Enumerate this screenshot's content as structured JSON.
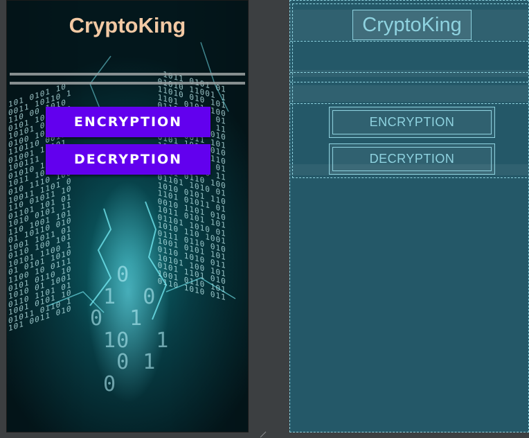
{
  "app": {
    "title": "CryptoKing"
  },
  "buttons": {
    "encryption": "ENCRYPTION",
    "decryption": "DECRYPTION"
  },
  "colors": {
    "title_text": "#f3c9a4",
    "button_bg": "#6200ee",
    "button_text": "#ffffff",
    "blueprint_bg": "#245868",
    "blueprint_line": "#8fd3e0",
    "ide_background": "#3c3f41"
  },
  "icons": {
    "resize_handle": "resize-handle-icon"
  }
}
